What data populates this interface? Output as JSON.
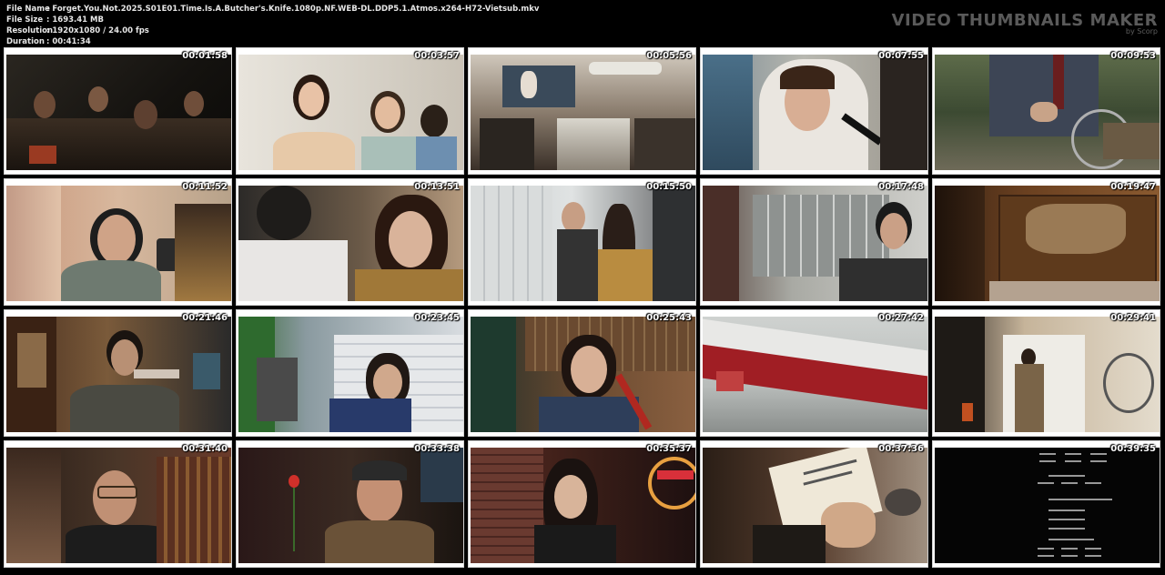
{
  "meta": {
    "file_name_label": "File Name",
    "file_name": "Forget.You.Not.2025.S01E01.Time.Is.A.Butcher's.Knife.1080p.NF.WEB-DL.DDP5.1.Atmos.x264-H72-Vietsub.mkv",
    "file_size_label": "File Size",
    "file_size": "1693.41 MB",
    "resolution_label": "Resolution",
    "resolution": "1920x1080 / 24.00 fps",
    "duration_label": "Duration",
    "duration": "00:41:34"
  },
  "brand": {
    "title": "VIDEO THUMBNAILS MAKER",
    "subtitle": "by Scorp"
  },
  "thumbnails": [
    {
      "time": "00:01:58"
    },
    {
      "time": "00:03:57"
    },
    {
      "time": "00:05:56"
    },
    {
      "time": "00:07:55"
    },
    {
      "time": "00:09:53"
    },
    {
      "time": "00:11:52"
    },
    {
      "time": "00:13:51"
    },
    {
      "time": "00:15:50"
    },
    {
      "time": "00:17:48"
    },
    {
      "time": "00:19:47"
    },
    {
      "time": "00:21:46"
    },
    {
      "time": "00:23:45"
    },
    {
      "time": "00:25:43"
    },
    {
      "time": "00:27:42"
    },
    {
      "time": "00:29:41"
    },
    {
      "time": "00:31:40"
    },
    {
      "time": "00:33:38"
    },
    {
      "time": "00:35:37"
    },
    {
      "time": "00:37:36"
    },
    {
      "time": "00:39:35"
    }
  ]
}
